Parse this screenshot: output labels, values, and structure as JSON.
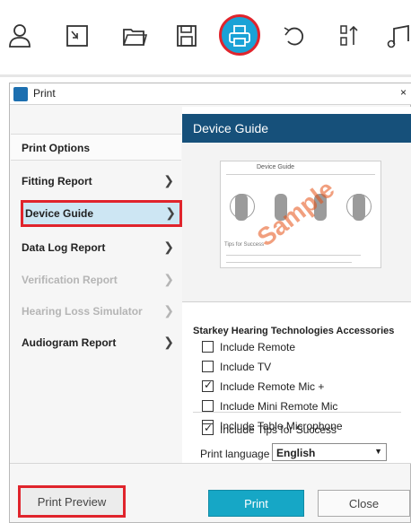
{
  "toolbar": {
    "icons": [
      "person-icon",
      "new-document-icon",
      "open-folder-icon",
      "save-icon",
      "print-icon",
      "undo-icon",
      "sort-icon",
      "music-note-icon"
    ],
    "highlight_color": "#e0242c",
    "active_color": "#1aa2d6"
  },
  "window": {
    "title": "Print",
    "close_glyph": "×"
  },
  "left": {
    "header": "Print Options",
    "options": [
      {
        "label": "Fitting Report",
        "state": "enabled"
      },
      {
        "label": "Device Guide",
        "state": "selected"
      },
      {
        "label": "Data Log Report",
        "state": "enabled"
      },
      {
        "label": "Verification Report",
        "state": "disabled"
      },
      {
        "label": "Hearing Loss Simulator",
        "state": "disabled"
      },
      {
        "label": "Audiogram Report",
        "state": "enabled"
      }
    ]
  },
  "right": {
    "header": "Device Guide",
    "preview": {
      "title": "Device Guide",
      "tips": "Tips for Success",
      "watermark": "Sample"
    },
    "accessories_title": "Starkey Hearing Technologies Accessories",
    "checkboxes": [
      {
        "label": "Include Remote",
        "checked": false
      },
      {
        "label": "Include TV",
        "checked": false
      },
      {
        "label": "Include Remote Mic +",
        "checked": true
      },
      {
        "label": "Include Mini Remote Mic",
        "checked": false
      },
      {
        "label": "Include Table Microphone",
        "checked": false
      }
    ],
    "tips_checkbox": {
      "label": "Include Tips for Success",
      "checked": true
    },
    "language_label": "Print language",
    "language_value": "English"
  },
  "buttons": {
    "preview": "Print Preview",
    "print": "Print",
    "close": "Close"
  },
  "colors": {
    "header_bg": "#16507a",
    "print_button": "#16a7c6",
    "selected_bg": "#cde6f3"
  }
}
